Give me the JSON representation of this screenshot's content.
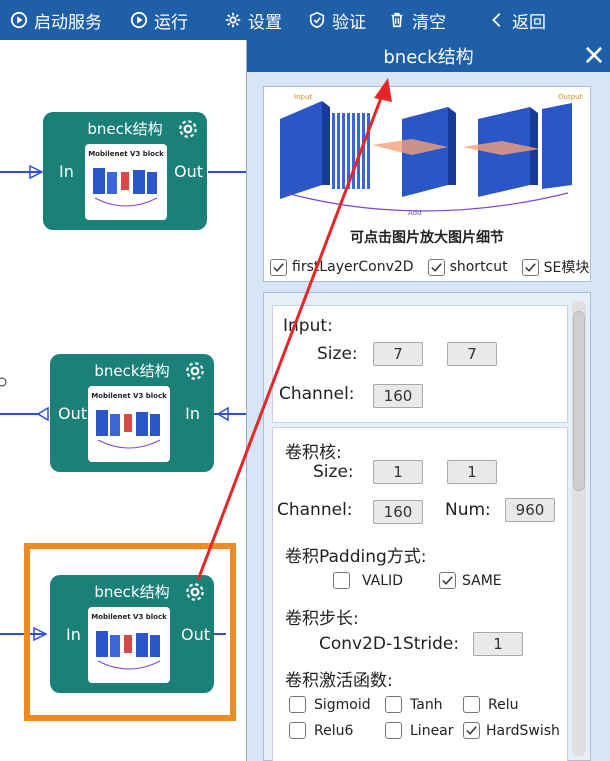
{
  "toolbar": {
    "items": [
      {
        "label": "启动服务",
        "icon": "play-circle-icon"
      },
      {
        "label": "运行",
        "icon": "play-icon"
      },
      {
        "label": "设置",
        "icon": "gear-icon"
      },
      {
        "label": "验证",
        "icon": "shield-check-icon"
      },
      {
        "label": "清空",
        "icon": "trash-icon"
      },
      {
        "label": "返回",
        "icon": "chevron-left-icon"
      }
    ],
    "color": "#1f5fa8"
  },
  "canvas": {
    "nodes": [
      {
        "title": "bneck结构",
        "left_port": "In",
        "right_port": "Out",
        "thumb_title": "Mobilenet V3 block"
      },
      {
        "title": "bneck结构",
        "left_port": "Out",
        "right_port": "In",
        "thumb_title": "Mobilenet V3 block"
      },
      {
        "title": "bneck结构",
        "left_port": "In",
        "right_port": "Out",
        "thumb_title": "Mobilenet V3 block"
      }
    ],
    "node_color": "#1a8078",
    "highlight_color": "#f28a22"
  },
  "panel": {
    "title": "bneck结构",
    "preview": {
      "caption": "可点击图片放大图片细节",
      "img_input_label": "Input",
      "img_output_label": "Output",
      "img_add_label": "Add"
    },
    "options": [
      {
        "label": "firstLayerConv2D",
        "checked": true
      },
      {
        "label": "shortcut",
        "checked": true
      },
      {
        "label": "SE模块",
        "checked": true
      }
    ],
    "input": {
      "heading": "Input:",
      "size_label": "Size:",
      "size_w": "7",
      "size_h": "7",
      "channel_label": "Channel:",
      "channel": "160"
    },
    "kernel": {
      "heading": "卷积核:",
      "size_label": "Size:",
      "size_w": "1",
      "size_h": "1",
      "channel_label": "Channel:",
      "channel": "160",
      "num_label": "Num:",
      "num": "960"
    },
    "padding": {
      "heading": "卷积Padding方式:",
      "options": [
        {
          "label": "VALID",
          "checked": false
        },
        {
          "label": "SAME",
          "checked": true
        }
      ]
    },
    "stride": {
      "heading": "卷积步长:",
      "label": "Conv2D-1Stride:",
      "value": "1"
    },
    "activation": {
      "heading": "卷积激活函数:",
      "options": [
        {
          "label": "Sigmoid",
          "checked": false
        },
        {
          "label": "Tanh",
          "checked": false
        },
        {
          "label": "Relu",
          "checked": false
        },
        {
          "label": "Relu6",
          "checked": false
        },
        {
          "label": "Linear",
          "checked": false
        },
        {
          "label": "HardSwish",
          "checked": true
        }
      ]
    }
  }
}
